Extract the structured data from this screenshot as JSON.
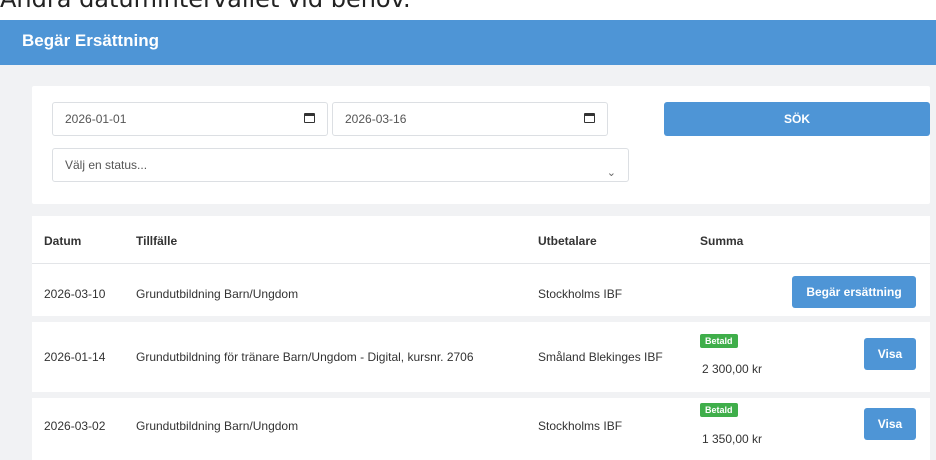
{
  "caption": "Ändra datumintervallet vid behov.",
  "header": {
    "title": "Begär Ersättning"
  },
  "filters": {
    "date_from": "2026-01-01",
    "date_to": "2026-03-16",
    "status_placeholder": "Välj en status...",
    "search_label": "SÖK"
  },
  "table": {
    "columns": [
      "Datum",
      "Tillfälle",
      "Utbetalare",
      "Summa"
    ],
    "rows": [
      {
        "date": "2026-03-10",
        "occasion": "Grundutbildning Barn/Ungdom",
        "payer": "Stockholms IBF",
        "status": "",
        "amount": "",
        "action": "Begär ersättning"
      },
      {
        "date": "2026-01-14",
        "occasion": "Grundutbildning för tränare Barn/Ungdom - Digital, kursnr. 2706",
        "payer": "Småland Blekinges IBF",
        "status": "Betald",
        "amount": "2 300,00 kr",
        "action": "Visa"
      },
      {
        "date": "2026-03-02",
        "occasion": "Grundutbildning Barn/Ungdom",
        "payer": "Stockholms IBF",
        "status": "Betald",
        "amount": "1 350,00 kr",
        "action": "Visa"
      }
    ]
  },
  "colors": {
    "header": "#4e95d6",
    "button": "#4e95d6",
    "paid_badge": "#3fae4a",
    "background": "#f1f2f4"
  }
}
